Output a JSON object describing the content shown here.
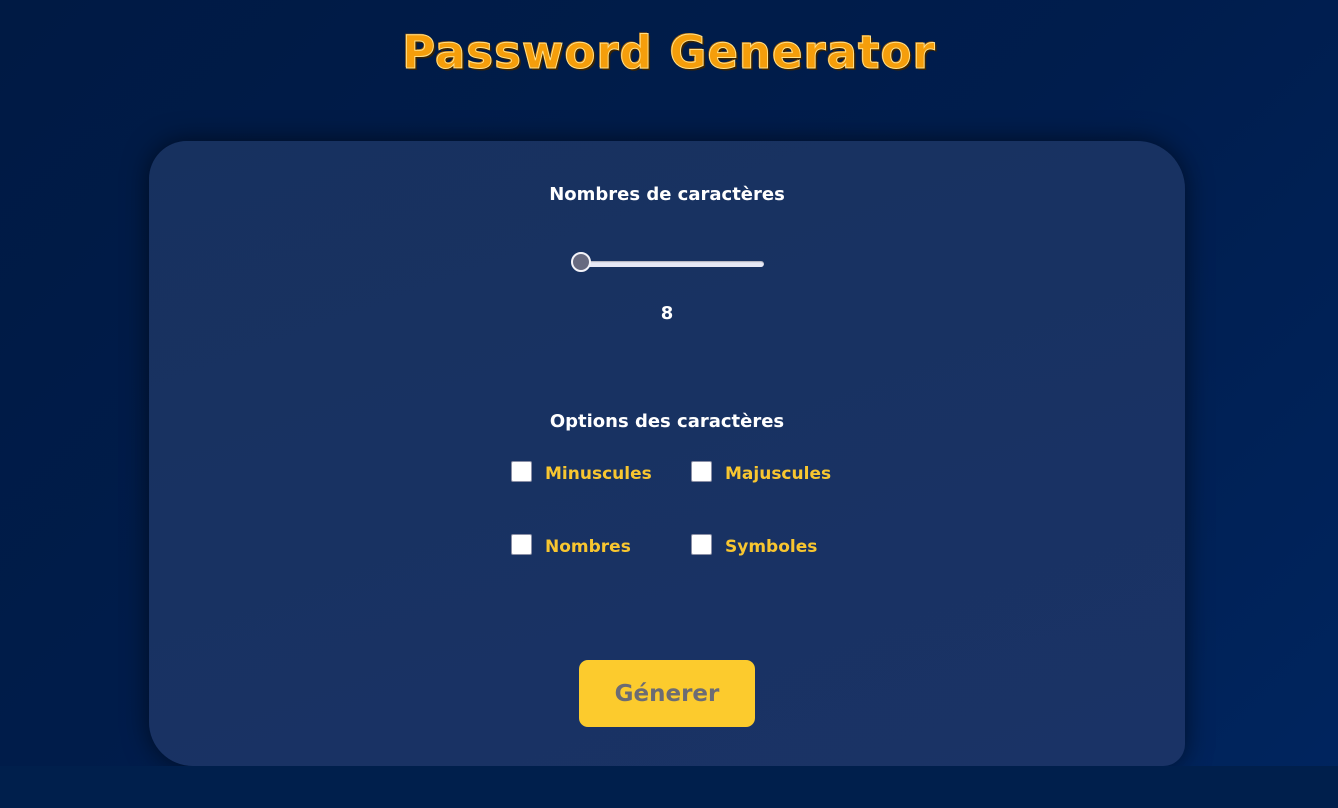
{
  "app": {
    "title": "Password Generator"
  },
  "length": {
    "label": "Nombres de caractères",
    "value": "8"
  },
  "options": {
    "label": "Options des caractères",
    "items": [
      {
        "label": "Minuscules",
        "checked": false
      },
      {
        "label": "Majuscules",
        "checked": false
      },
      {
        "label": "Nombres",
        "checked": false
      },
      {
        "label": "Symboles",
        "checked": false
      }
    ]
  },
  "actions": {
    "generate_label": "Génerer"
  },
  "colors": {
    "background": "#001d4d",
    "card": "#18326a",
    "title": "#f59e0b",
    "option_text": "#f8c630",
    "button": "#fccb2d",
    "button_text": "#6c6c74"
  }
}
